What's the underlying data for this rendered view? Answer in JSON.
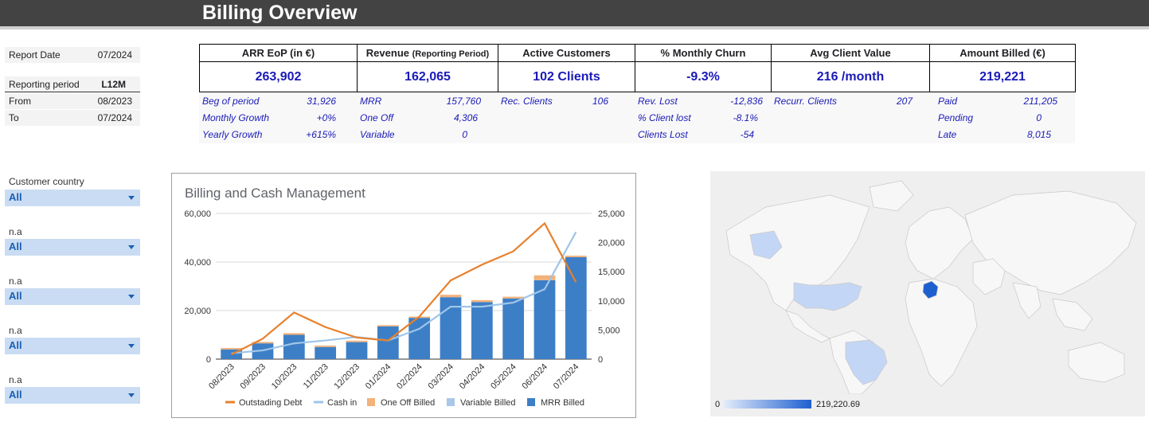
{
  "header": {
    "title": "Billing Overview"
  },
  "report_info": {
    "report_date_label": "Report Date",
    "report_date": "07/2024",
    "period_label": "Reporting period",
    "period": "L12M",
    "from_label": "From",
    "from": "08/2023",
    "to_label": "To",
    "to": "07/2024"
  },
  "kpis": [
    {
      "header": "ARR EoP (in €)",
      "value": "263,902"
    },
    {
      "header": "Revenue",
      "header_small": "(Reporting Period)",
      "value": "162,065"
    },
    {
      "header": "Active Customers",
      "value": "102 Clients"
    },
    {
      "header": "% Monthly Churn",
      "value": "-9.3%"
    },
    {
      "header": "Avg Client Value",
      "value": "216 /month"
    },
    {
      "header": "Amount Billed (€)",
      "value": "219,221"
    }
  ],
  "sub_metrics": {
    "arr": [
      {
        "label": "Beg of period",
        "value": "31,926"
      },
      {
        "label": "Monthly Growth",
        "value": "+0%"
      },
      {
        "label": "Yearly Growth",
        "value": "+615%"
      }
    ],
    "revenue": [
      {
        "label": "MRR",
        "value": "157,760"
      },
      {
        "label": "One Off",
        "value": "4,306"
      },
      {
        "label": "Variable",
        "value": "0"
      }
    ],
    "customers": [
      {
        "label": "Rec. Clients",
        "value": "106"
      }
    ],
    "churn": [
      {
        "label": "Rev. Lost",
        "value": "-12,836"
      },
      {
        "label": "% Client lost",
        "value": "-8.1%"
      },
      {
        "label": "Clients Lost",
        "value": "-54"
      }
    ],
    "avg": [
      {
        "label": "Recurr. Clients",
        "value": "207"
      }
    ],
    "billed": [
      {
        "label": "Paid",
        "value": "211,205"
      },
      {
        "label": "Pending",
        "value": "0"
      },
      {
        "label": "Late",
        "value": "8,015"
      }
    ]
  },
  "filters": [
    {
      "label": "Customer country",
      "value": "All"
    },
    {
      "label": "n.a",
      "value": "All"
    },
    {
      "label": "n.a",
      "value": "All"
    },
    {
      "label": "n.a",
      "value": "All"
    },
    {
      "label": "n.a",
      "value": "All"
    }
  ],
  "chart_data": {
    "type": "bar",
    "title": "Billing and Cash Management",
    "categories": [
      "08/2023",
      "09/2023",
      "10/2023",
      "11/2023",
      "12/2023",
      "01/2024",
      "02/2024",
      "03/2024",
      "04/2024",
      "05/2024",
      "06/2024",
      "07/2024"
    ],
    "stacked": true,
    "left_axis": {
      "ylim": [
        0,
        60000
      ],
      "ticks": [
        "60,000",
        "40,000",
        "20,000",
        "0"
      ]
    },
    "right_axis": {
      "ylim": [
        0,
        25000
      ],
      "ticks": [
        "25,000",
        "20,000",
        "15,000",
        "10,000",
        "5,000",
        "0"
      ]
    },
    "series": [
      {
        "name": "MRR Billed",
        "kind": "bar",
        "axis": "left",
        "color": "#3d7fc6",
        "values": [
          4000,
          6500,
          10000,
          5000,
          7000,
          13500,
          17000,
          25500,
          23500,
          25000,
          32500,
          42000
        ]
      },
      {
        "name": "Variable Billed",
        "kind": "bar",
        "axis": "left",
        "color": "#a9c8e8",
        "values": [
          0,
          0,
          0,
          0,
          0,
          0,
          0,
          0,
          0,
          0,
          0,
          0
        ]
      },
      {
        "name": "One Off Billed",
        "kind": "bar",
        "axis": "left",
        "color": "#f2b27a",
        "values": [
          600,
          600,
          700,
          600,
          600,
          500,
          500,
          1000,
          800,
          700,
          2000,
          600
        ]
      },
      {
        "name": "Cash in",
        "kind": "line",
        "axis": "right",
        "color": "#9fc5e8",
        "values": [
          1000,
          1500,
          2700,
          3200,
          3800,
          3200,
          5200,
          9000,
          9000,
          9700,
          12000,
          21800
        ]
      },
      {
        "name": "Outstading Debt",
        "kind": "line",
        "axis": "right",
        "color": "#e8802c",
        "values": [
          800,
          3500,
          8000,
          5500,
          3700,
          3200,
          7300,
          13500,
          16200,
          18500,
          23300,
          13200
        ]
      }
    ],
    "legend": [
      "Outstading Debt",
      "Cash in",
      "One Off Billed",
      "Variable Billed",
      "MRR Billed"
    ],
    "legend_position": "bottom",
    "grid": true
  },
  "geo_map": {
    "legend_min": "0",
    "legend_max": "219,220.69",
    "color_low": "#e3ecfb",
    "color_high": "#1e5fd0"
  }
}
